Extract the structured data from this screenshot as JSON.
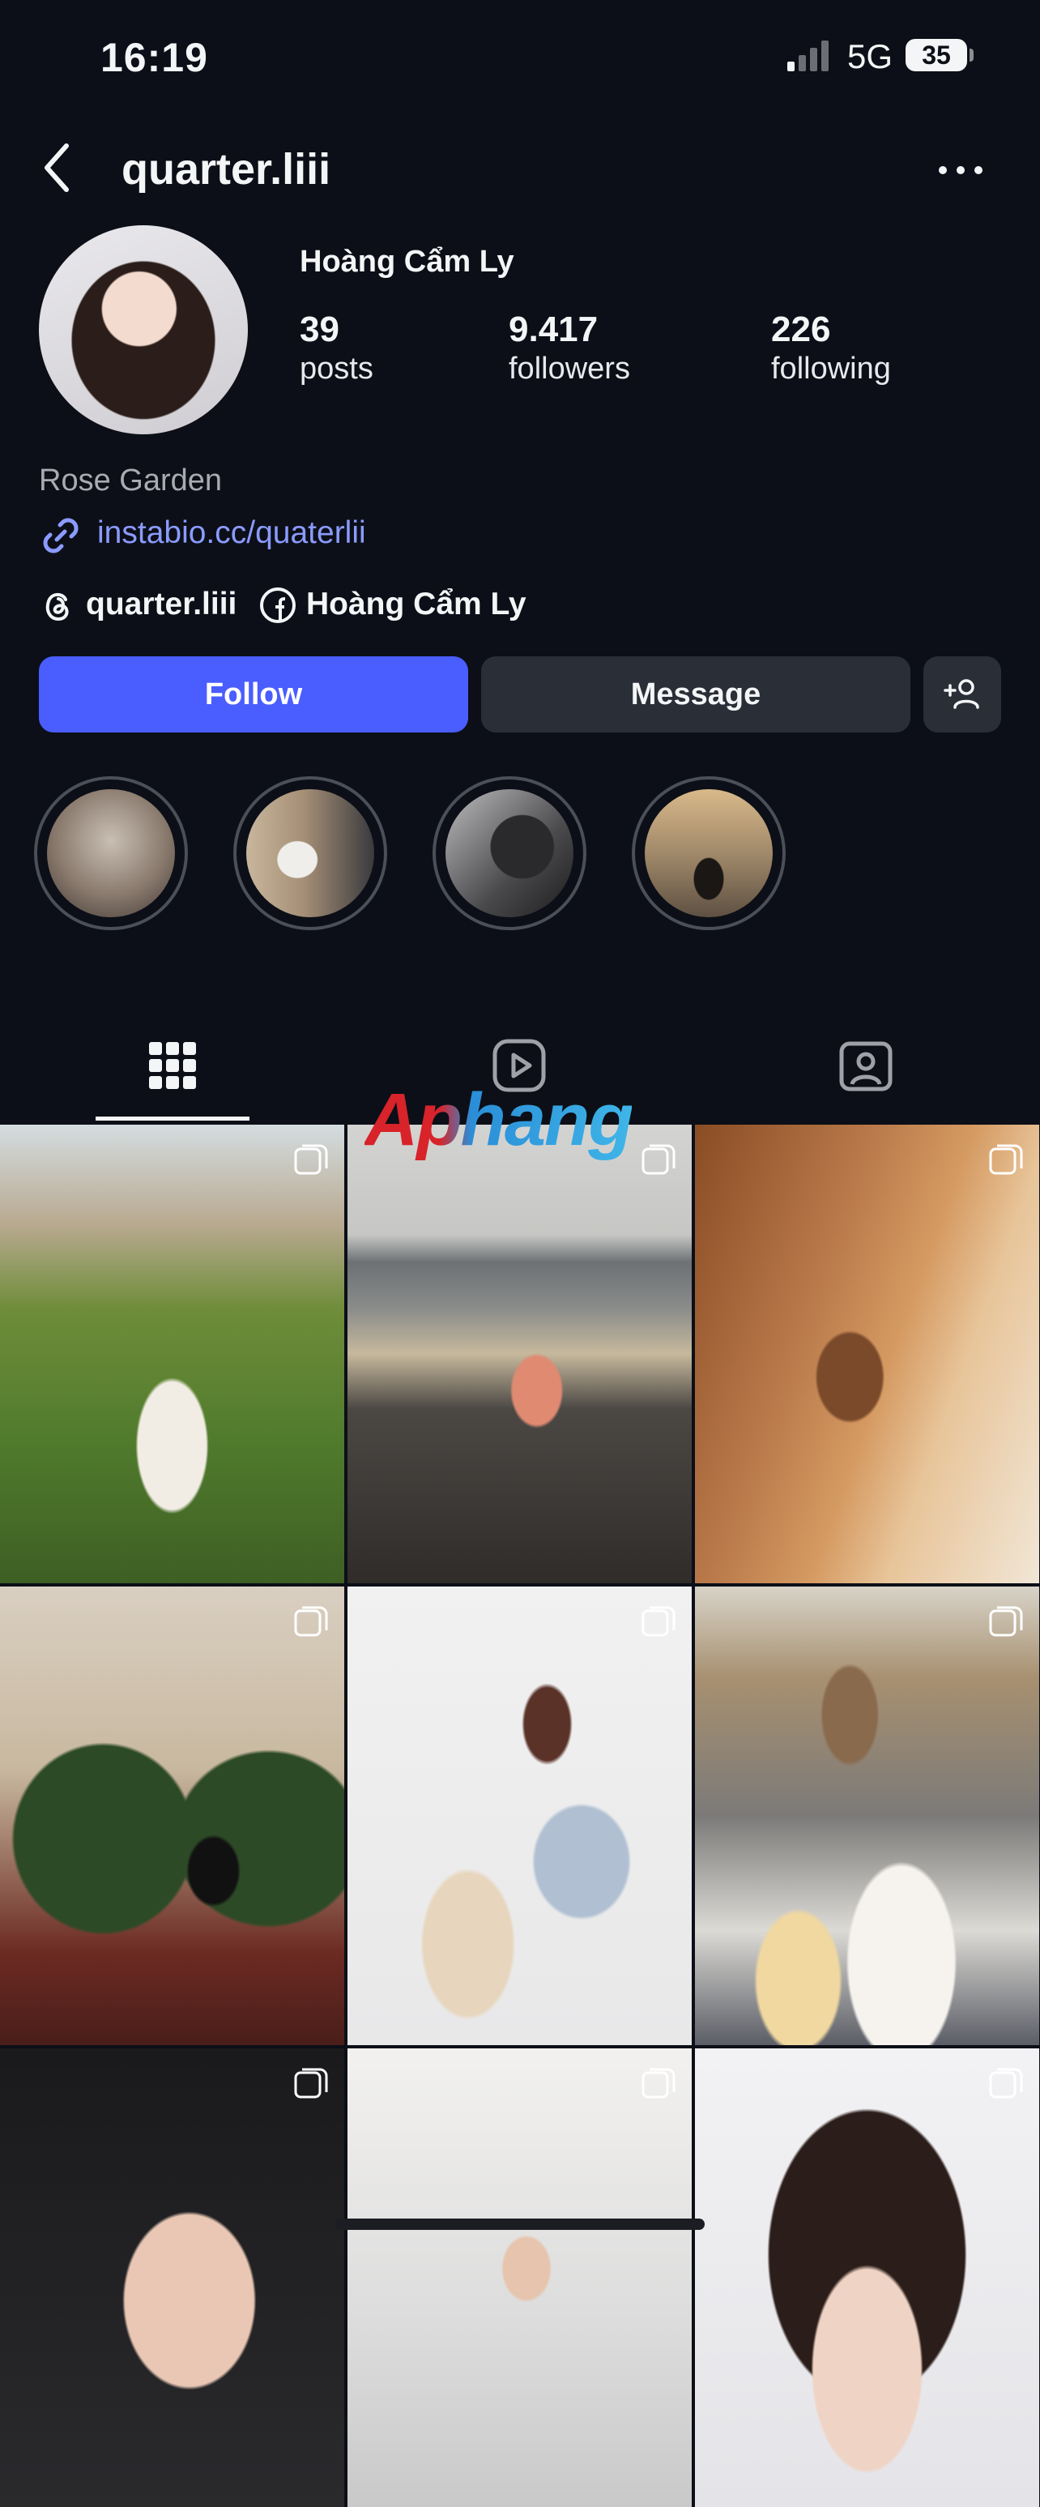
{
  "status_bar": {
    "time": "16:19",
    "network": "5G",
    "battery": "35"
  },
  "header": {
    "username": "quarter.liii"
  },
  "profile": {
    "full_name": "Hoàng Cẩm Ly",
    "stats": [
      {
        "value": "39",
        "label": "posts"
      },
      {
        "value": "9.417",
        "label": "followers"
      },
      {
        "value": "226",
        "label": "following"
      }
    ],
    "bio": "Rose Garden",
    "link": "instabio.cc/quaterlii",
    "threads_handle": "quarter.liii",
    "facebook_name": "Hoàng Cẩm Ly"
  },
  "actions": {
    "follow_label": "Follow",
    "message_label": "Message"
  },
  "highlights": [
    {
      "color": "#8a7a6e"
    },
    {
      "color": "#a58f76"
    },
    {
      "color": "#4a4a4d"
    },
    {
      "color": "#9a8466"
    }
  ],
  "tabs": [
    {
      "icon": "grid-icon",
      "active": true
    },
    {
      "icon": "reels-icon",
      "active": false
    },
    {
      "icon": "tagged-icon",
      "active": false
    }
  ],
  "watermark": "Aphang",
  "grid_posts": [
    {
      "scene": "tropical resort garden",
      "multi": true
    },
    {
      "scene": "beach rocks",
      "multi": true
    },
    {
      "scene": "wooden staircase",
      "multi": true
    },
    {
      "scene": "christmas trees",
      "multi": true
    },
    {
      "scene": "studio with cat",
      "multi": true
    },
    {
      "scene": "cafe dining",
      "multi": true
    },
    {
      "scene": "portrait",
      "multi": true
    },
    {
      "scene": "white staircase",
      "multi": true
    },
    {
      "scene": "portrait close-up",
      "multi": true
    }
  ]
}
